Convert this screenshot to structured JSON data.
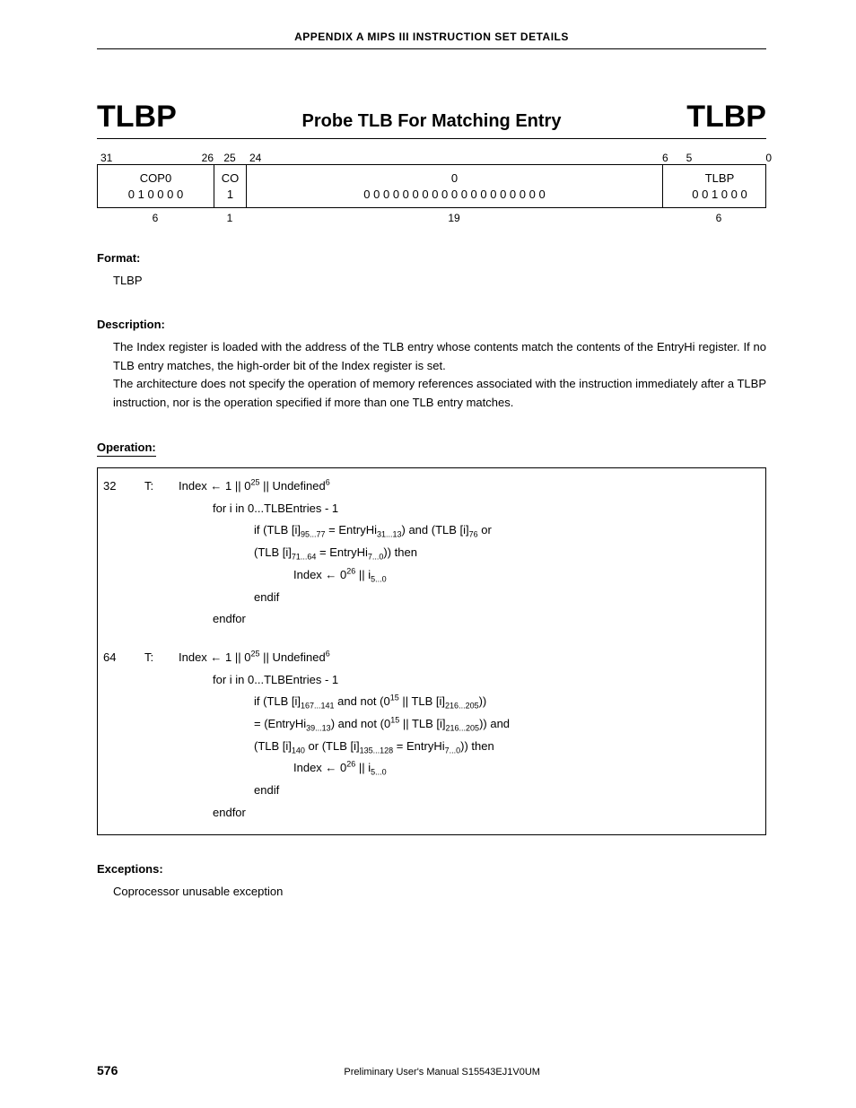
{
  "header": {
    "appendix": "APPENDIX  A   MIPS III INSTRUCTION SET DETAILS"
  },
  "title": {
    "left": "TLBP",
    "center": "Probe TLB For Matching Entry",
    "right": "TLBP"
  },
  "encoding": {
    "bits": {
      "c1_left": "31",
      "c1_right": "26",
      "c2": "25",
      "c3_left": "24",
      "c3_right": "",
      "c4_left": "6",
      "c4_mid": "5",
      "c4_right": "0"
    },
    "cells": {
      "c1_top": "COP0",
      "c1_bot": "0 1 0 0 0 0",
      "c2_top": "CO",
      "c2_bot": "1",
      "c3_top": "0",
      "c3_bot": "0 0 0   0 0 0 0   0 0 0 0   0 0 0 0   0 0 0 0",
      "c4_top": "TLBP",
      "c4_bot": "0 0 1 0 0 0"
    },
    "widths": {
      "c1": "6",
      "c2": "1",
      "c3": "19",
      "c4": "6"
    }
  },
  "format": {
    "label": "Format:",
    "body": "TLBP"
  },
  "description": {
    "label": "Description:",
    "p1": "The Index register is loaded with the address of the TLB entry whose contents match the contents of the EntryHi register.  If no TLB entry matches, the high-order bit of the Index register is set.",
    "p2": "The architecture does not specify the operation of memory references associated with the instruction immediately after a TLBP instruction, nor is the operation specified if more than one TLB entry matches."
  },
  "operation": {
    "label": "Operation:"
  },
  "chart_data": {
    "type": "table",
    "title": "TLBP pseudo-code operation (32-bit and 64-bit modes)",
    "blocks": [
      {
        "mode": 32,
        "stage": "T:",
        "lines": [
          "Index ← 1 || 0^25 || Undefined^6",
          "for i in 0...TLBEntries - 1",
          "  if (TLB [i]_{95...77} = EntryHi_{31...13}) and (TLB [i]_{76} or",
          "    (TLB [i]_{71...64} = EntryHi_{7...0})) then",
          "      Index ← 0^26 || i_{5...0}",
          "  endif",
          "endfor"
        ]
      },
      {
        "mode": 64,
        "stage": "T:",
        "lines": [
          "Index ← 1 || 0^25 || Undefined^6",
          "for i in 0...TLBEntries - 1",
          "  if (TLB [i]_{167...141} and not (0^15 || TLB [i]_{216...205}))",
          "    = (EntryHi_{39...13}) and not (0^15 || TLB [i]_{216...205})) and",
          "    (TLB [i]_{140} or (TLB [i]_{135...128} = EntryHi_{7...0})) then",
          "      Index ← 0^26 || i_{5...0}",
          "  endif",
          "endfor"
        ]
      }
    ]
  },
  "ops_render": {
    "b32": {
      "mode": "32",
      "t": "T:",
      "l0": "Index ← 1 || 0",
      "l0_sup": "25",
      "l0_tail": " || Undefined",
      "l0_sup2": "6",
      "l1": "for i in 0...TLBEntries - 1",
      "l2_a": "if (TLB [i]",
      "l2_s1": "95...77",
      "l2_b": " = EntryHi",
      "l2_s2": "31...13",
      "l2_c": ") and (TLB [i]",
      "l2_s3": "76",
      "l2_d": " or",
      "l3_a": "(TLB [i]",
      "l3_s1": "71...64",
      "l3_b": " = EntryHi",
      "l3_s2": "7...0",
      "l3_c": ")) then",
      "l4_a": "Index ← 0",
      "l4_sup": "26",
      "l4_b": " || i",
      "l4_sub": "5...0",
      "l5": "endif",
      "l6": "endfor"
    },
    "b64": {
      "mode": "64",
      "t": "T:",
      "l0": "Index ← 1 || 0",
      "l0_sup": "25",
      "l0_tail": " || Undefined",
      "l0_sup2": "6",
      "l1": "for i in 0...TLBEntries - 1",
      "l2_a": "if (TLB [i]",
      "l2_s1": "167...141",
      "l2_b": " and not (0",
      "l2_sup": "15",
      "l2_c": " || TLB [i]",
      "l2_s2": "216...205",
      "l2_d": "))",
      "l3_a": "= (EntryHi",
      "l3_s1": "39...13",
      "l3_b": ") and not (0",
      "l3_sup": "15",
      "l3_c": " || TLB [i]",
      "l3_s2": "216...205",
      "l3_d": ")) and",
      "l4_a": "(TLB [i]",
      "l4_s1": "140",
      "l4_b": " or (TLB [i]",
      "l4_s2": "135...128",
      "l4_c": " = EntryHi",
      "l4_s3": "7...0",
      "l4_d": ")) then",
      "l5_a": "Index ← 0",
      "l5_sup": "26",
      "l5_b": " || i",
      "l5_sub": "5...0",
      "l6": "endif",
      "l7": "endfor"
    }
  },
  "exceptions": {
    "label": "Exceptions:",
    "body": "Coprocessor unusable exception"
  },
  "footer": {
    "page": "576",
    "text": "Preliminary User's Manual  S15543EJ1V0UM"
  }
}
